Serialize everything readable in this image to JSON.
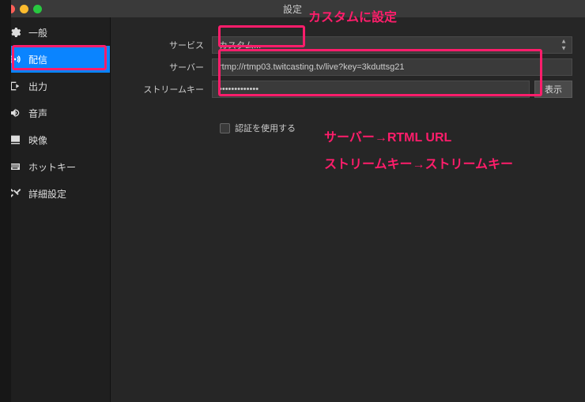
{
  "window": {
    "title": "設定"
  },
  "sidebar": {
    "items": [
      {
        "label": "一般"
      },
      {
        "label": "配信"
      },
      {
        "label": "出力"
      },
      {
        "label": "音声"
      },
      {
        "label": "映像"
      },
      {
        "label": "ホットキー"
      },
      {
        "label": "詳細設定"
      }
    ]
  },
  "form": {
    "service_label": "サービス",
    "service_value": "カスタム...",
    "server_label": "サーバー",
    "server_value": "rtmp://rtmp03.twitcasting.tv/live?key=3kduttsg21",
    "streamkey_label": "ストリームキー",
    "streamkey_value": "•••••••••••••",
    "show_button": "表示",
    "auth_checkbox_label": "認証を使用する"
  },
  "annotations": {
    "a1": "カスタムに設定",
    "a2": "サーバー→RTML URL",
    "a3": "ストリームキー→ストリームキー"
  }
}
